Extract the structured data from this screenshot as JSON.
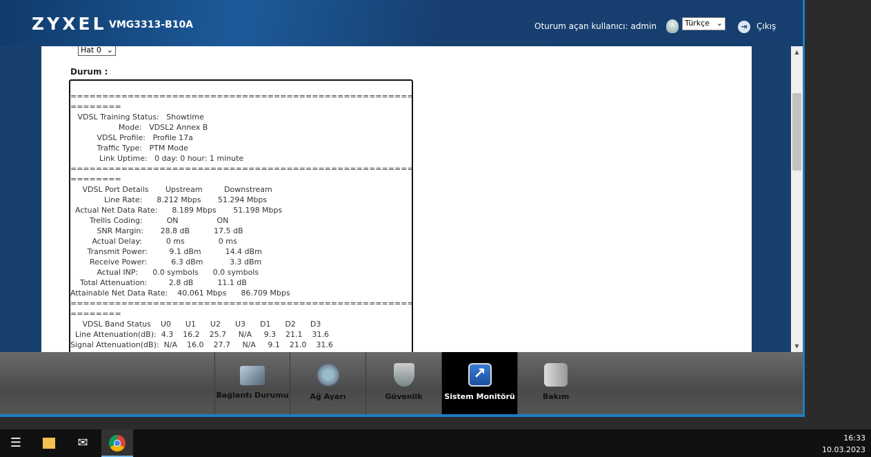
{
  "header": {
    "brand": "ZYXEL",
    "model": "VMG3313-B10A",
    "user_label": "Oturum açan kullanıcı: admin",
    "language": "Türkçe",
    "logout": "Çıkış"
  },
  "content": {
    "line_select": "Hat 0",
    "status_label": "Durum :",
    "status_lines": [
      "==================================================================",
      "========",
      "   VDSL Training Status:   Showtime",
      "                    Mode:   VDSL2 Annex B",
      "           VDSL Profile:   Profile 17a",
      "           Traffic Type:   PTM Mode",
      "            Link Uptime:   0 day: 0 hour: 1 minute",
      "==================================================================",
      "========",
      "     VDSL Port Details       Upstream         Downstream",
      "              Line Rate:      8.212 Mbps       51.294 Mbps",
      "  Actual Net Data Rate:      8.189 Mbps       51.198 Mbps",
      "        Trellis Coding:          ON                ON",
      "           SNR Margin:       28.8 dB          17.5 dB",
      "         Actual Delay:          0 ms              0 ms",
      "       Transmit Power:         9.1 dBm          14.4 dBm",
      "        Receive Power:          6.3 dBm           3.3 dBm",
      "           Actual INP:      0.0 symbols      0.0 symbols",
      "    Total Attenuation:         2.8 dB          11.1 dB",
      "Attainable Net Data Rate:    40.061 Mbps      86.709 Mbps",
      "==================================================================",
      "========",
      "     VDSL Band Status    U0      U1      U2      U3      D1      D2      D3",
      "  Line Attenuation(dB):  4.3    16.2    25.7     N/A     9.3    21.1    31.6",
      "Signal Attenuation(dB):  N/A    16.0    27.7     N/A     9.1    21.0    31.6"
    ]
  },
  "nav": [
    {
      "label": "Bağlantı Durumu"
    },
    {
      "label": "Ağ Ayarı"
    },
    {
      "label": "Güvenlik"
    },
    {
      "label": "Sistem Monitörü"
    },
    {
      "label": "Bakım"
    }
  ],
  "taskbar": {
    "time": "16:33",
    "date": "10.03.2023"
  }
}
